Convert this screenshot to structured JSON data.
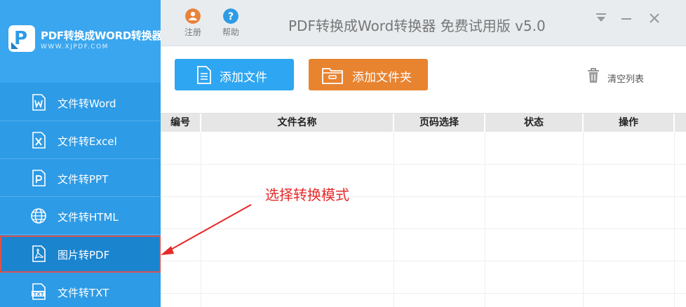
{
  "app": {
    "logo_title": "PDF转换成WORD转换器",
    "logo_url": "WWW.XJPDF.COM",
    "window_title": "PDF转换成Word转换器 免费试用版 v5.0"
  },
  "topbar": {
    "register_label": "注册",
    "help_label": "帮助"
  },
  "sidebar": {
    "items": [
      {
        "label": "文件转Word",
        "icon": "word-file-icon"
      },
      {
        "label": "文件转Excel",
        "icon": "excel-file-icon"
      },
      {
        "label": "文件转PPT",
        "icon": "ppt-file-icon"
      },
      {
        "label": "文件转HTML",
        "icon": "globe-icon"
      },
      {
        "label": "图片转PDF",
        "icon": "pdf-file-icon",
        "active": true
      },
      {
        "label": "文件转TXT",
        "icon": "txt-file-icon"
      }
    ]
  },
  "toolbar": {
    "add_file_label": "添加文件",
    "add_folder_label": "添加文件夹",
    "clear_list_label": "清空列表"
  },
  "table": {
    "columns": [
      "编号",
      "文件名称",
      "页码选择",
      "状态",
      "操作"
    ]
  },
  "annotation": {
    "text": "选择转换模式"
  },
  "colors": {
    "sidebar": "#2d9be6",
    "active_item": "#1b84cf",
    "add_file": "#2ea6f2",
    "add_folder": "#e8832f",
    "annotation": "#e8292a"
  }
}
